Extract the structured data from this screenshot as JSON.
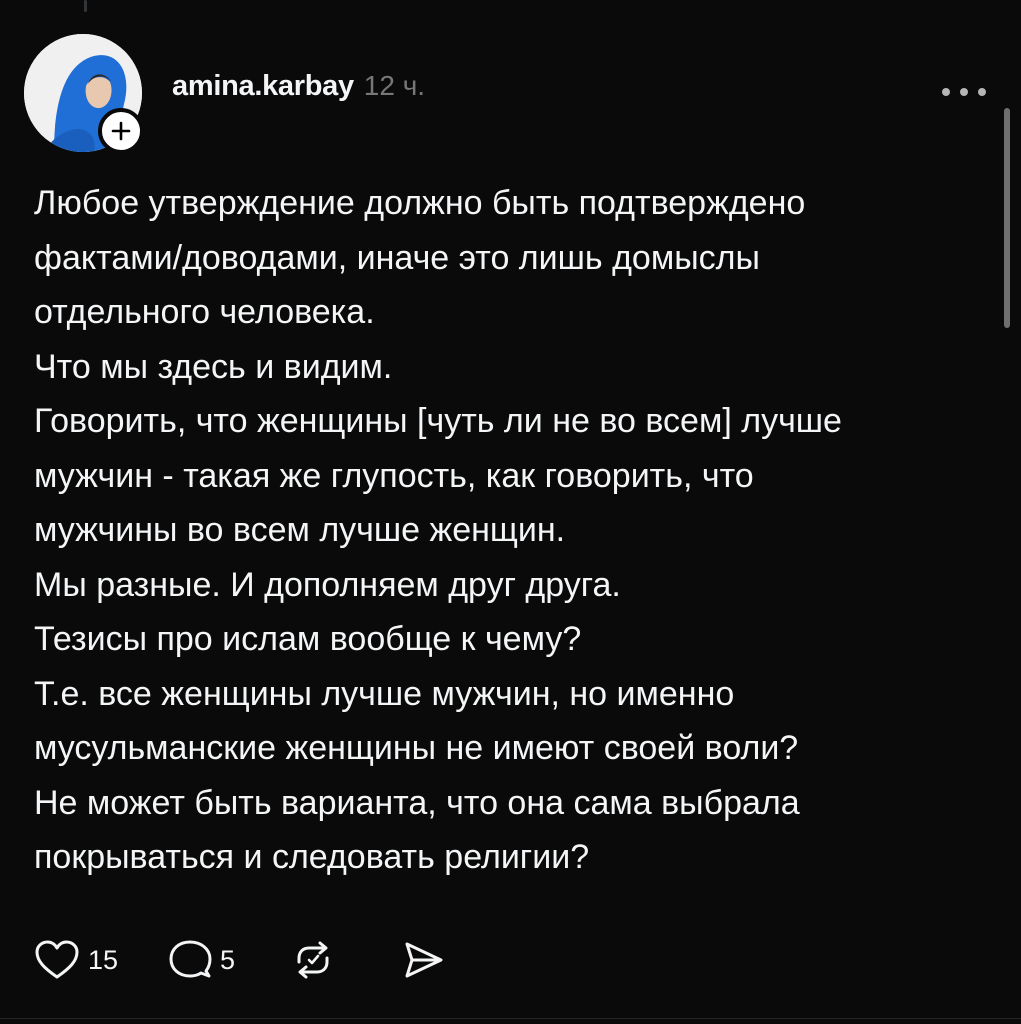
{
  "post": {
    "author": {
      "username": "amina.karbay",
      "time_ago": "12 ч."
    },
    "text_lines": [
      "Любое утверждение должно быть подтверждено",
      "фактами/доводами, иначе это лишь домыслы",
      "отдельного человека.",
      "Что мы здесь и видим.",
      "Говорить, что женщины [чуть ли не во всем] лучше",
      "мужчин - такая же глупость, как говорить, что",
      "мужчины во всем лучше женщин.",
      "Мы разные. И дополняем друг друга.",
      "Тезисы про ислам вообще к чему?",
      "Т.е. все женщины лучше мужчин, но именно",
      "мусульманские женщины не имеют своей воли?",
      "Не может быть варианта, что она сама выбрала",
      "покрываться и следовать религии?"
    ],
    "actions": {
      "likes": "15",
      "replies": "5"
    }
  },
  "icons": {
    "more": "more-options-icon",
    "follow": "plus-icon",
    "like": "heart-icon",
    "reply": "comment-bubble-icon",
    "repost": "repost-icon",
    "share": "send-icon"
  },
  "colors": {
    "background": "#0a0a0a",
    "text": "#f3f5f7",
    "secondary_text": "#777777",
    "hijab_blue": "#1f6fd6"
  }
}
